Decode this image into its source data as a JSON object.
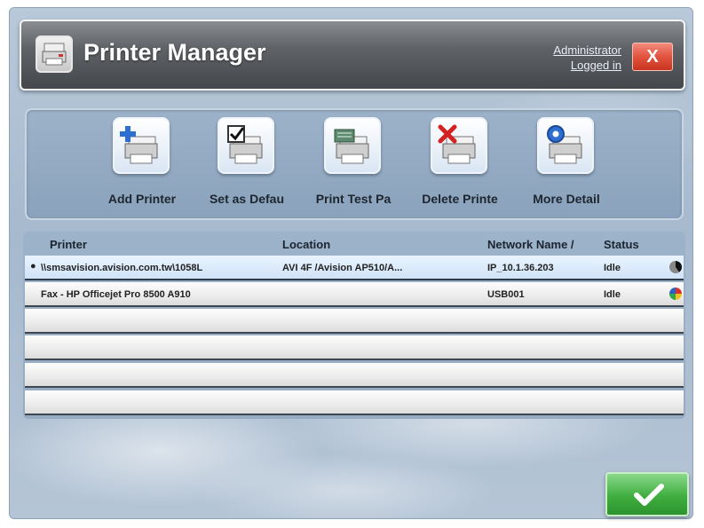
{
  "window": {
    "title": "Printer Manager",
    "user_line1": "Administrator",
    "user_line2": "Logged in",
    "close_label": "X"
  },
  "toolbar": {
    "buttons": [
      {
        "label": "Add Printer",
        "icon": "add-printer-icon"
      },
      {
        "label": "Set as Defau",
        "icon": "set-default-icon"
      },
      {
        "label": "Print Test Pa",
        "icon": "print-test-page-icon"
      },
      {
        "label": "Delete Printe",
        "icon": "delete-printer-icon"
      },
      {
        "label": "More Detail",
        "icon": "more-detail-icon"
      }
    ]
  },
  "table": {
    "columns": [
      "Printer",
      "Location",
      "Network Name /",
      "Status"
    ],
    "rows": [
      {
        "printer": "\\\\smsavision.avision.com.tw\\1058L",
        "location": "AVI 4F /Avision AP510/A...",
        "network": "IP_10.1.36.203",
        "status": "Idle",
        "selected": true,
        "status_icon": "monochrome-printer-icon"
      },
      {
        "printer": "Fax - HP Officejet Pro 8500 A910",
        "location": "",
        "network": "USB001",
        "status": "Idle",
        "selected": false,
        "status_icon": "color-printer-icon"
      },
      {
        "printer": "",
        "location": "",
        "network": "",
        "status": ""
      },
      {
        "printer": "",
        "location": "",
        "network": "",
        "status": ""
      },
      {
        "printer": "",
        "location": "",
        "network": "",
        "status": ""
      },
      {
        "printer": "",
        "location": "",
        "network": "",
        "status": ""
      }
    ],
    "selected_marker": "●"
  },
  "footer": {
    "ok_icon": "checkmark-icon"
  },
  "colors": {
    "close": "#e1533f",
    "ok": "#3fae3f",
    "background": "#a6b9cd"
  }
}
